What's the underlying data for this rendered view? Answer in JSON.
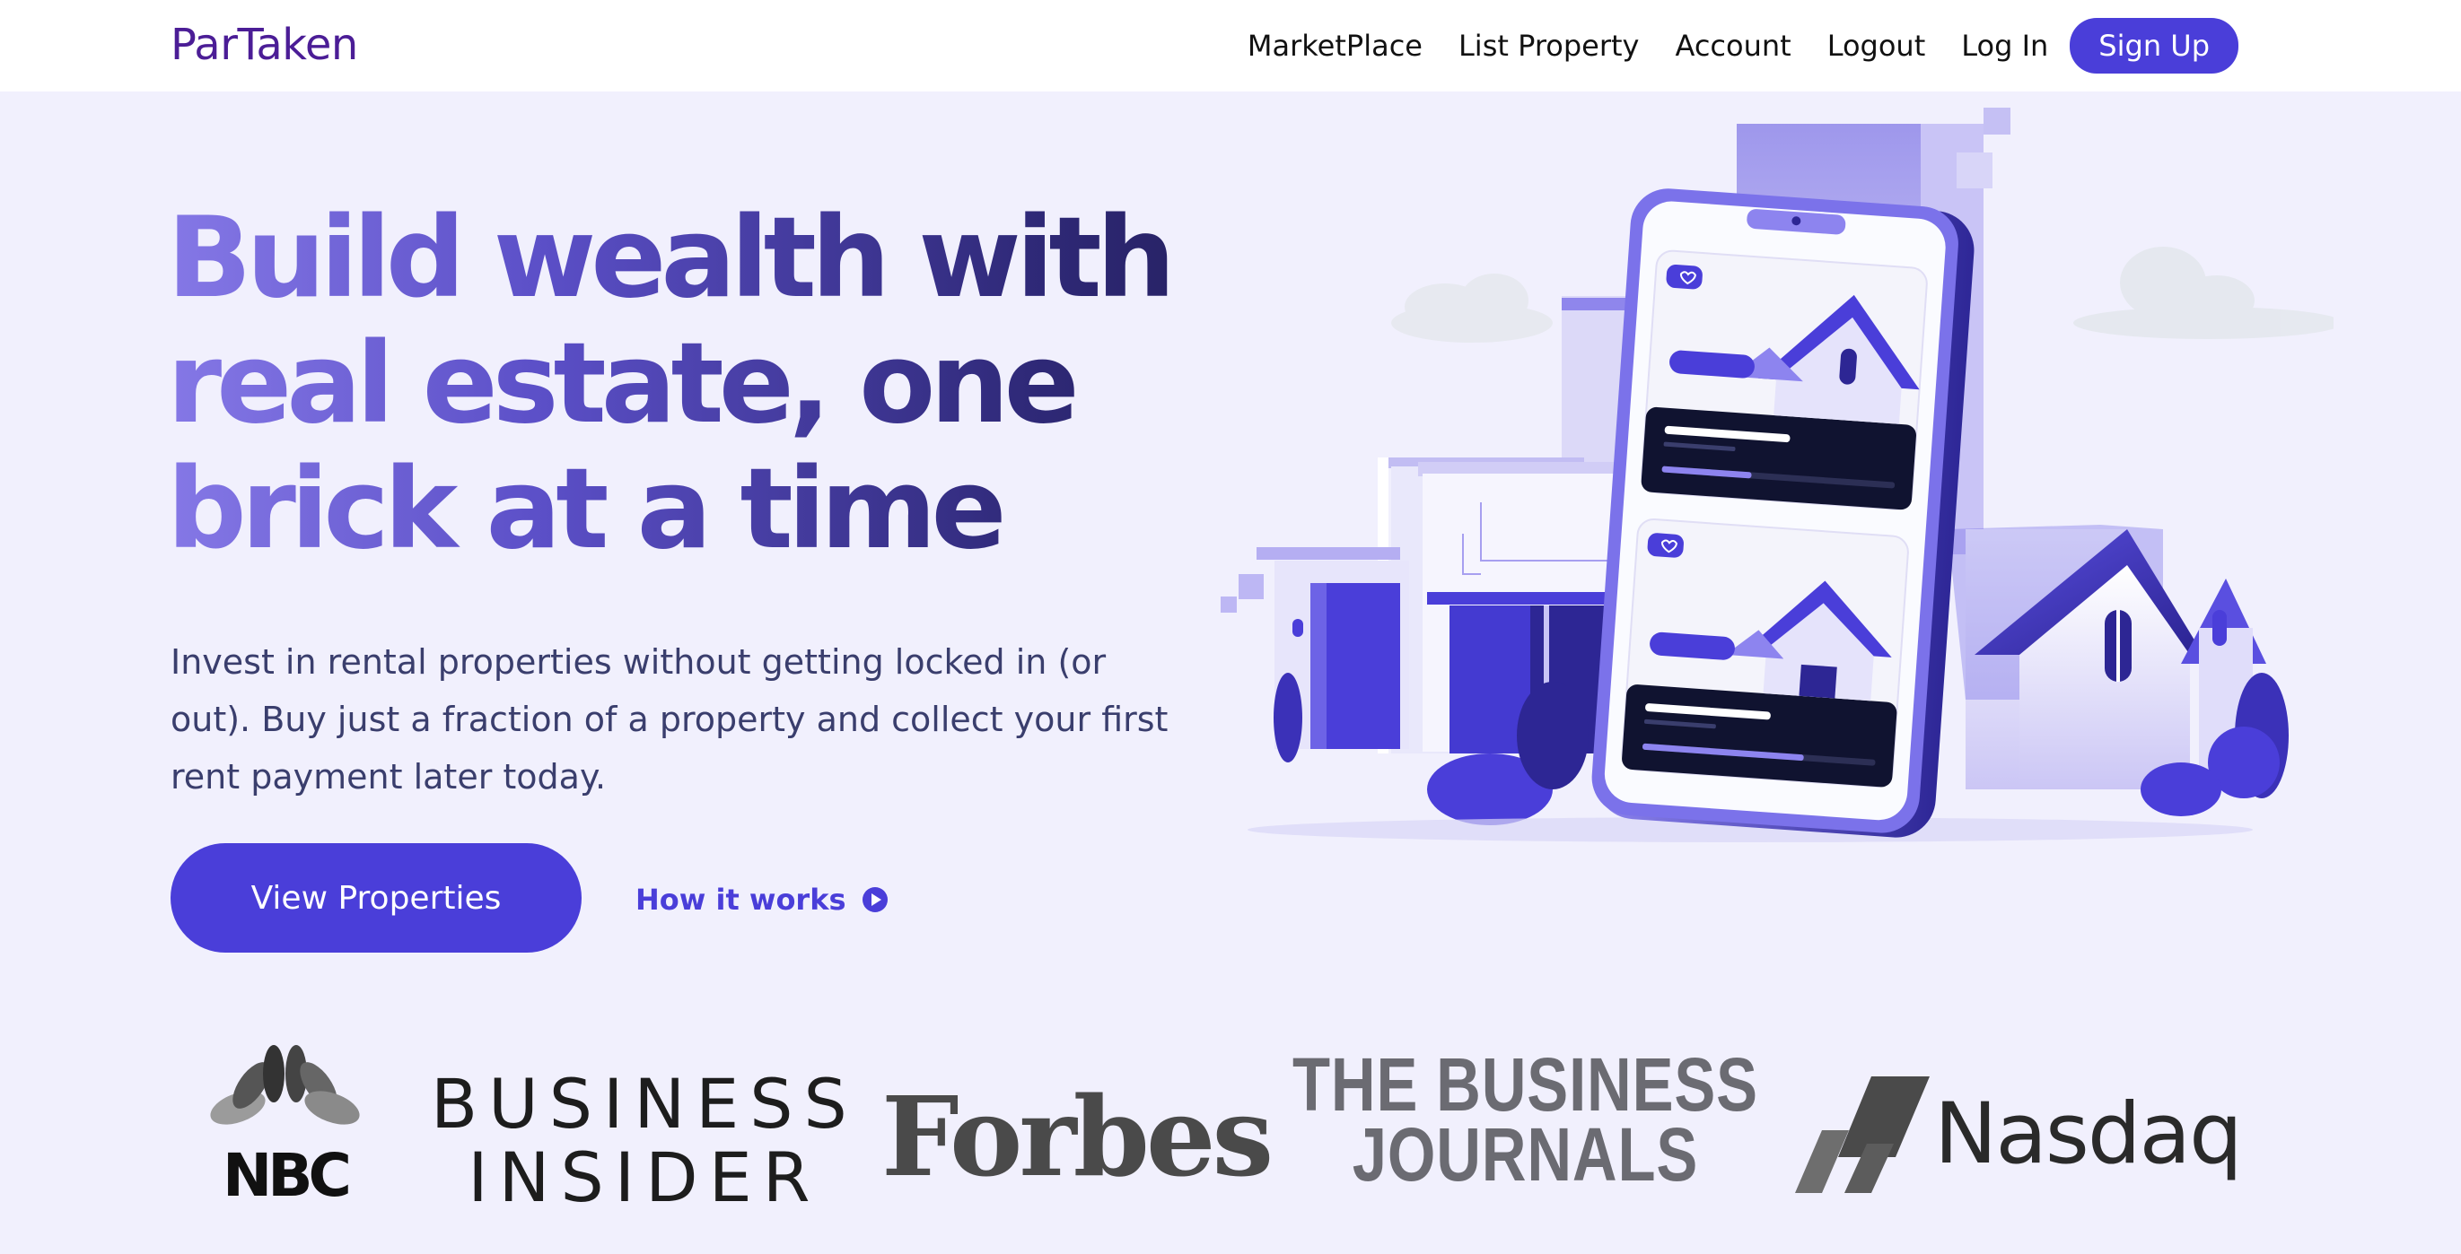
{
  "header": {
    "logo": "ParTaken",
    "nav": [
      "MarketPlace",
      "List Property",
      "Account",
      "Logout",
      "Log In"
    ],
    "signup": "Sign Up"
  },
  "hero": {
    "title_line1": "Build wealth with",
    "title_line2": "real estate, one",
    "title_line3": "brick at a time",
    "subtitle": "Invest in rental properties without getting locked in (or out). Buy just a fraction of a property and collect your first rent payment later today.",
    "primary_cta": "View Properties",
    "secondary_cta": "How it works"
  },
  "press": {
    "nbc": "NBC",
    "bi_line1": "BUSINESS",
    "bi_line2": "INSIDER",
    "forbes": "Forbes",
    "tbj_line1": "THE BUSINESS",
    "tbj_line2": "JOURNALS",
    "nasdaq": "Nasdaq"
  },
  "colors": {
    "brand": "#4a3ed9",
    "logo": "#4b1d96",
    "background": "#f1f0fd"
  }
}
